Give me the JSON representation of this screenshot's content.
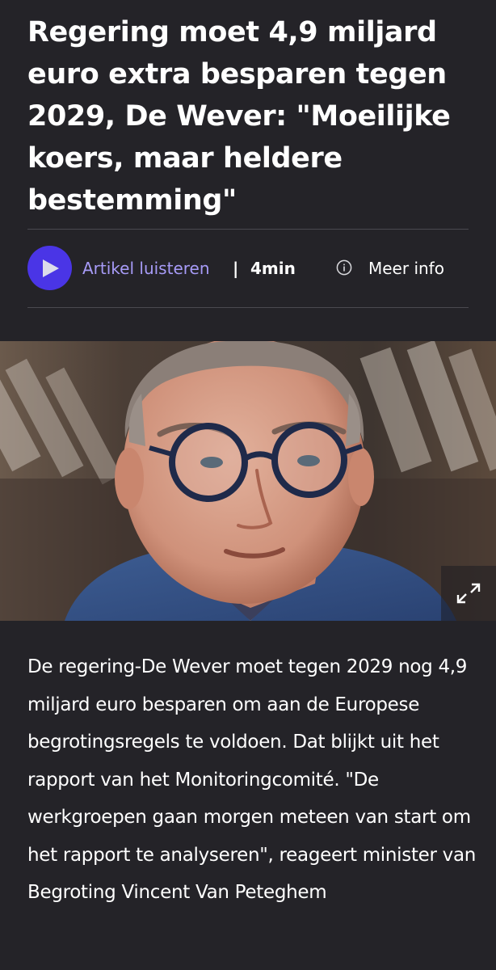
{
  "article": {
    "headline": "Regering moet 4,9 miljard euro extra besparen tegen 2029, De Wever: \"Moeilijke koers, maar heldere bestemming\"",
    "audio": {
      "listen_label": "Artikel luisteren",
      "separator": "|",
      "duration": "4min",
      "info_label": "Meer info"
    },
    "body": "De regering-De Wever moet tegen 2029 nog 4,9 miljard euro besparen om aan de Europese begrotingsregels te voldoen. Dat blijkt uit het rapport van het Monitoringcomité.  \"De werkgroepen gaan morgen meteen van start om het rapport te analyseren\", reageert minister van Begroting Vincent Van Peteghem"
  },
  "icons": {
    "play": "play-icon",
    "info": "info-circle-icon",
    "expand": "expand-icon"
  },
  "colors": {
    "background": "#242328",
    "accent": "#4a35e6",
    "link": "#a79bf7",
    "text": "#ffffff"
  }
}
